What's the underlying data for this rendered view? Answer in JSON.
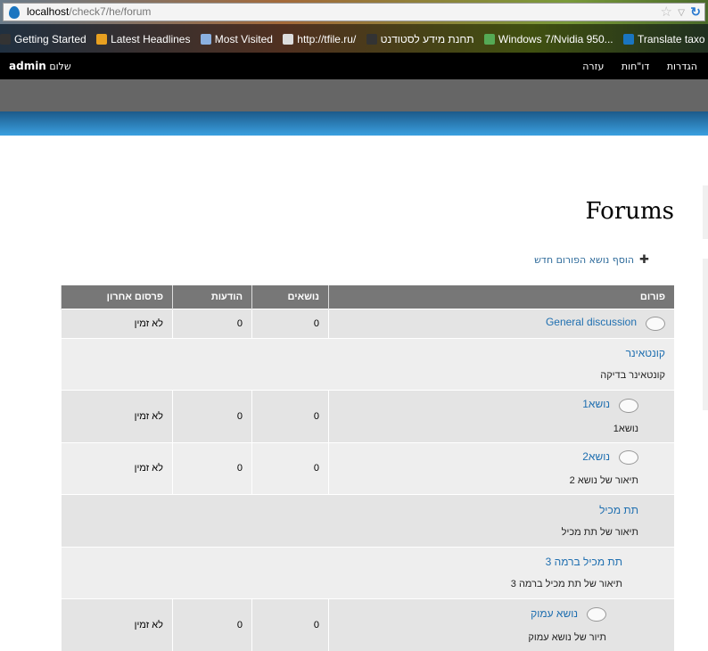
{
  "browser": {
    "url_host": "localhost",
    "url_path": "/check7/he/forum",
    "bookmarks": [
      "Getting Started",
      "Latest Headlines",
      "Most Visited",
      "http://tfile.ru/",
      "תחנת מידע לסטודנט",
      "Windows 7/Nvidia 950...",
      "Translate taxo"
    ]
  },
  "topbar": {
    "user": "admin",
    "greeting": "שלום",
    "menu": [
      "הגדרות",
      "דו\"חות",
      "עזרה"
    ]
  },
  "page": {
    "title": "Forums",
    "add_link": "הוסף נושא הפורום חדש"
  },
  "table": {
    "headers": [
      "פורום",
      "נושאים",
      "הודעות",
      "פרסום אחרון"
    ],
    "rows": [
      {
        "name": "General discussion",
        "desc": "",
        "topics": "0",
        "posts": "0",
        "last": "לא זמין",
        "icon": true,
        "indent": 0
      },
      {
        "name": "קונטאינר",
        "desc": "קונטאינר בדיקה",
        "topics": "",
        "posts": "",
        "last": "",
        "icon": false,
        "indent": 0
      },
      {
        "name": "נושא1",
        "desc": "נושא1",
        "topics": "0",
        "posts": "0",
        "last": "לא זמין",
        "icon": true,
        "indent": 1
      },
      {
        "name": "נושא2",
        "desc": "תיאור של נושא 2",
        "topics": "0",
        "posts": "0",
        "last": "לא זמין",
        "icon": true,
        "indent": 1
      },
      {
        "name": "תת מכיל",
        "desc": "תיאור של תת מכיל",
        "topics": "",
        "posts": "",
        "last": "",
        "icon": false,
        "indent": 1
      },
      {
        "name": "תת מכיל ברמה 3",
        "desc": "תיאור של תת מכיל ברמה 3",
        "topics": "",
        "posts": "",
        "last": "",
        "icon": false,
        "indent": 2
      },
      {
        "name": "נושא עמוק",
        "desc": "תיור של נושא עמוק",
        "topics": "0",
        "posts": "0",
        "last": "לא זמין",
        "icon": true,
        "indent": 3
      }
    ]
  }
}
